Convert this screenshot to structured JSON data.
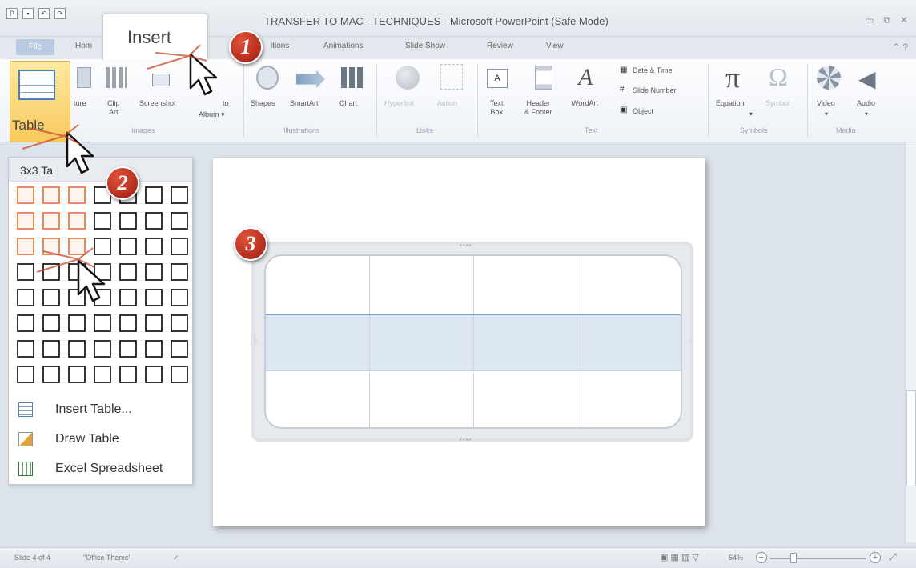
{
  "window": {
    "title": "TRANSFER TO MAC - TECHNIQUES  -  Microsoft PowerPoint (Safe Mode)"
  },
  "tabs": {
    "file": "File",
    "home": "Hom",
    "insert": "Insert",
    "transitions": "itions",
    "animations": "Animations",
    "slideshow": "Slide Show",
    "review": "Review",
    "view": "View"
  },
  "ribbon": {
    "table_label": "Table",
    "images": {
      "picture": "ture",
      "clip_art": "Clip\nArt",
      "screenshot": "Screenshot",
      "photo_album": "Album",
      "photo_album_top": "to",
      "group_label": "Images"
    },
    "illustrations": {
      "shapes": "Shapes",
      "smartart": "SmartArt",
      "chart": "Chart",
      "group_label": "Illustrations"
    },
    "links": {
      "hyperlink": "Hyperlink",
      "action": "Action",
      "group_label": "Links"
    },
    "text": {
      "textbox": "Text\nBox",
      "header_footer": "Header\n& Footer",
      "wordart": "WordArt",
      "date_time": "Date & Time",
      "slide_number": "Slide Number",
      "object": "Object",
      "group_label": "Text"
    },
    "symbols": {
      "equation": "Equation",
      "symbol": "Symbol",
      "group_label": "Symbols"
    },
    "media": {
      "video": "Video",
      "audio": "Audio",
      "group_label": "Media"
    }
  },
  "dropdown": {
    "title": "3x3 Ta",
    "grid": {
      "cols": 7,
      "rows": 8,
      "selected_cols": 3,
      "selected_rows": 3
    },
    "items": [
      {
        "label": "Insert Table...",
        "icon": "insert-table-icon"
      },
      {
        "label": "Draw Table",
        "icon": "draw-table-icon"
      },
      {
        "label": "Excel Spreadsheet",
        "icon": "excel-icon"
      }
    ]
  },
  "badges": [
    "1",
    "2",
    "3"
  ],
  "statusbar": {
    "slide": "Slide 4 of 4",
    "theme": "\"Office Theme\"",
    "zoom": "54%"
  },
  "colors": {
    "accent_orange": "#f08a5d",
    "badge_red": "#b52a1a",
    "table_highlight": "#dde6f3"
  }
}
